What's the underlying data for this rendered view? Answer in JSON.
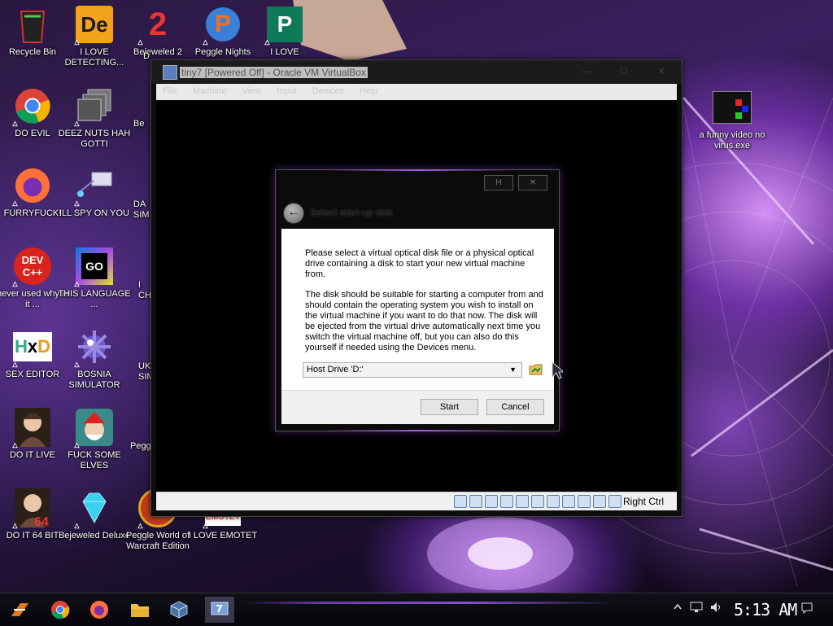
{
  "desktop": {
    "icons": [
      {
        "id": "recycle-bin",
        "label": "Recycle Bin",
        "icon": "recycle-bin-icon",
        "col": 0,
        "row": 0
      },
      {
        "id": "i-love-detecting",
        "label": "I LOVE DETECTING...",
        "icon": "de-app-icon",
        "col": 1,
        "row": 0
      },
      {
        "id": "bejeweled-2",
        "label": "Bejeweled 2",
        "icon": "bejeweled-2-icon",
        "col": 2,
        "row": 0
      },
      {
        "id": "peggle-nights",
        "label": "Peggle Nights",
        "icon": "peggle-nights-icon",
        "col": 3,
        "row": 0
      },
      {
        "id": "i-love-publisher",
        "label": "I LOVE",
        "icon": "publisher-icon",
        "col": 4,
        "row": 0
      },
      {
        "id": "do-evil",
        "label": "DO EVIL",
        "icon": "chrome-icon",
        "col": 0,
        "row": 1
      },
      {
        "id": "deez-nuts",
        "label": "DEEZ NUTS HAH GOTTI",
        "icon": "stacked-windows-icon",
        "col": 1,
        "row": 1
      },
      {
        "id": "furryfuck",
        "label": "FURRYFUCK!",
        "icon": "firefox-icon",
        "col": 0,
        "row": 2
      },
      {
        "id": "ill-spy-on-you",
        "label": "ILL SPY ON YOU",
        "icon": "network-spy-icon",
        "col": 1,
        "row": 2
      },
      {
        "id": "never-used",
        "label": "never used why is it ...",
        "icon": "dev-cpp-icon",
        "col": 0,
        "row": 3
      },
      {
        "id": "this-language",
        "label": "THIS LANGUAGE ...",
        "icon": "goland-icon",
        "col": 1,
        "row": 3
      },
      {
        "id": "sex-editor",
        "label": "SEX EDITOR",
        "icon": "hxd-icon",
        "col": 0,
        "row": 4
      },
      {
        "id": "bosnia-simulator",
        "label": "BOSNIA SIMULATOR",
        "icon": "mine-icon",
        "col": 1,
        "row": 4
      },
      {
        "id": "do-it-live",
        "label": "DO IT LIVE",
        "icon": "portrait-icon",
        "col": 0,
        "row": 5
      },
      {
        "id": "fuck-some-elves",
        "label": "FUCK SOME ELVES",
        "icon": "santa-icon",
        "col": 1,
        "row": 5
      },
      {
        "id": "do-it-64-bit",
        "label": "DO IT 64 BIT",
        "icon": "portrait-64-icon",
        "col": 0,
        "row": 6
      },
      {
        "id": "bejeweled-deluxe",
        "label": "Bejeweled Deluxe",
        "icon": "diamond-icon",
        "col": 1,
        "row": 6
      },
      {
        "id": "peggle-wow",
        "label": "Peggle World of Warcraft Edition",
        "icon": "peggle-wow-icon",
        "col": 2,
        "row": 6
      },
      {
        "id": "i-love-emotet",
        "label": "I LOVE EMOTET",
        "icon": "emotet-icon",
        "col": 3,
        "row": 6
      },
      {
        "id": "funny-video",
        "label": "a funny video no virus.exe",
        "icon": "video-thumbnail-icon",
        "col": "right",
        "row": 1
      }
    ],
    "partial_labels": {
      "row1": "Be",
      "row2": "DA\nSIM",
      "row3": "I\nCH",
      "row4": "UK\nSIM",
      "row5": "Pegg",
      "row6": "D"
    }
  },
  "vbox": {
    "title": "tiny7 [Powered Off] - Oracle VM VirtualBox",
    "window_buttons": [
      "—",
      "☐",
      "✕"
    ],
    "menu": [
      "File",
      "Machine",
      "View",
      "Input",
      "Devices",
      "Help"
    ],
    "status_icons": [
      "hard-disk-icon",
      "optical-disk-icon",
      "audio-icon",
      "network-icon",
      "usb-icon",
      "shared-folder-icon",
      "display-icon",
      "video-capture-icon",
      "cpu-icon",
      "mouse-integration-icon",
      "host-key-icon"
    ],
    "right_ctrl": "Right Ctrl"
  },
  "dialog": {
    "caption_help": "H",
    "caption_close": "✕",
    "title": "Select start-up disk",
    "para1": "Please select a virtual optical disk file or a physical optical drive containing a disk to start your new virtual machine from.",
    "para2": "The disk should be suitable for starting a computer from and should contain the operating system you wish to install on the virtual machine if you want to do that now. The disk will be ejected from the virtual drive automatically next time you switch the virtual machine off, but you can also do this yourself if needed using the Devices menu.",
    "combo_value": "Host Drive 'D:'",
    "start": "Start",
    "cancel": "Cancel"
  },
  "taskbar": {
    "items": [
      "start-icon",
      "chrome-icon",
      "firefox-icon",
      "file-explorer-icon",
      "virtualbox-icon",
      "virtualbox-vm-icon"
    ],
    "clock": "5:13 AM"
  },
  "colors": {
    "accent_purple": "#8a50d0",
    "vbox_blue": "#5a7fbf",
    "dialog_body": "#ffffff"
  }
}
